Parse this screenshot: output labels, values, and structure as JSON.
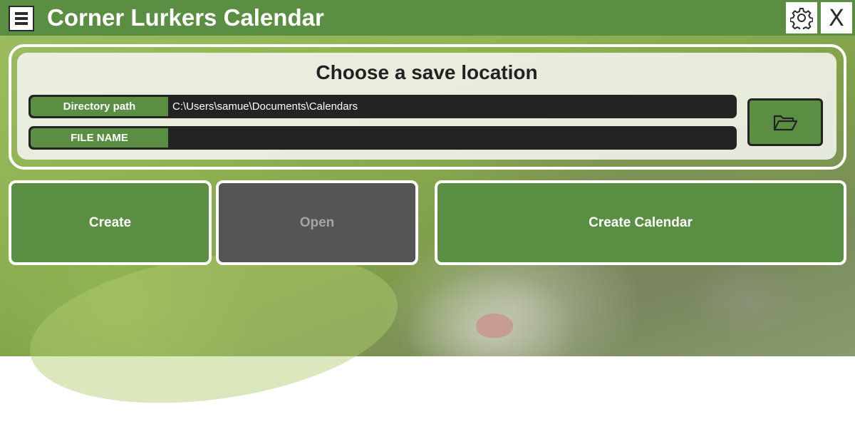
{
  "window": {
    "title": "Corner Lurkers Calendar",
    "icons": {
      "app": "calendar-document-icon",
      "settings": "gear-icon"
    },
    "close_label": "X"
  },
  "save_location": {
    "title": "Choose a save location",
    "directory": {
      "label": "Directory path",
      "value": "C:\\Users\\samue\\Documents\\Calendars"
    },
    "file_name": {
      "label": "FILE NAME",
      "value": ""
    },
    "browse_icon": "folder-open-icon"
  },
  "actions": {
    "create": "Create",
    "open": "Open",
    "create_calendar": "Create Calendar"
  },
  "colors": {
    "accent": "#5a8f43",
    "field_background": "#232323",
    "disabled_button": "#555555"
  }
}
